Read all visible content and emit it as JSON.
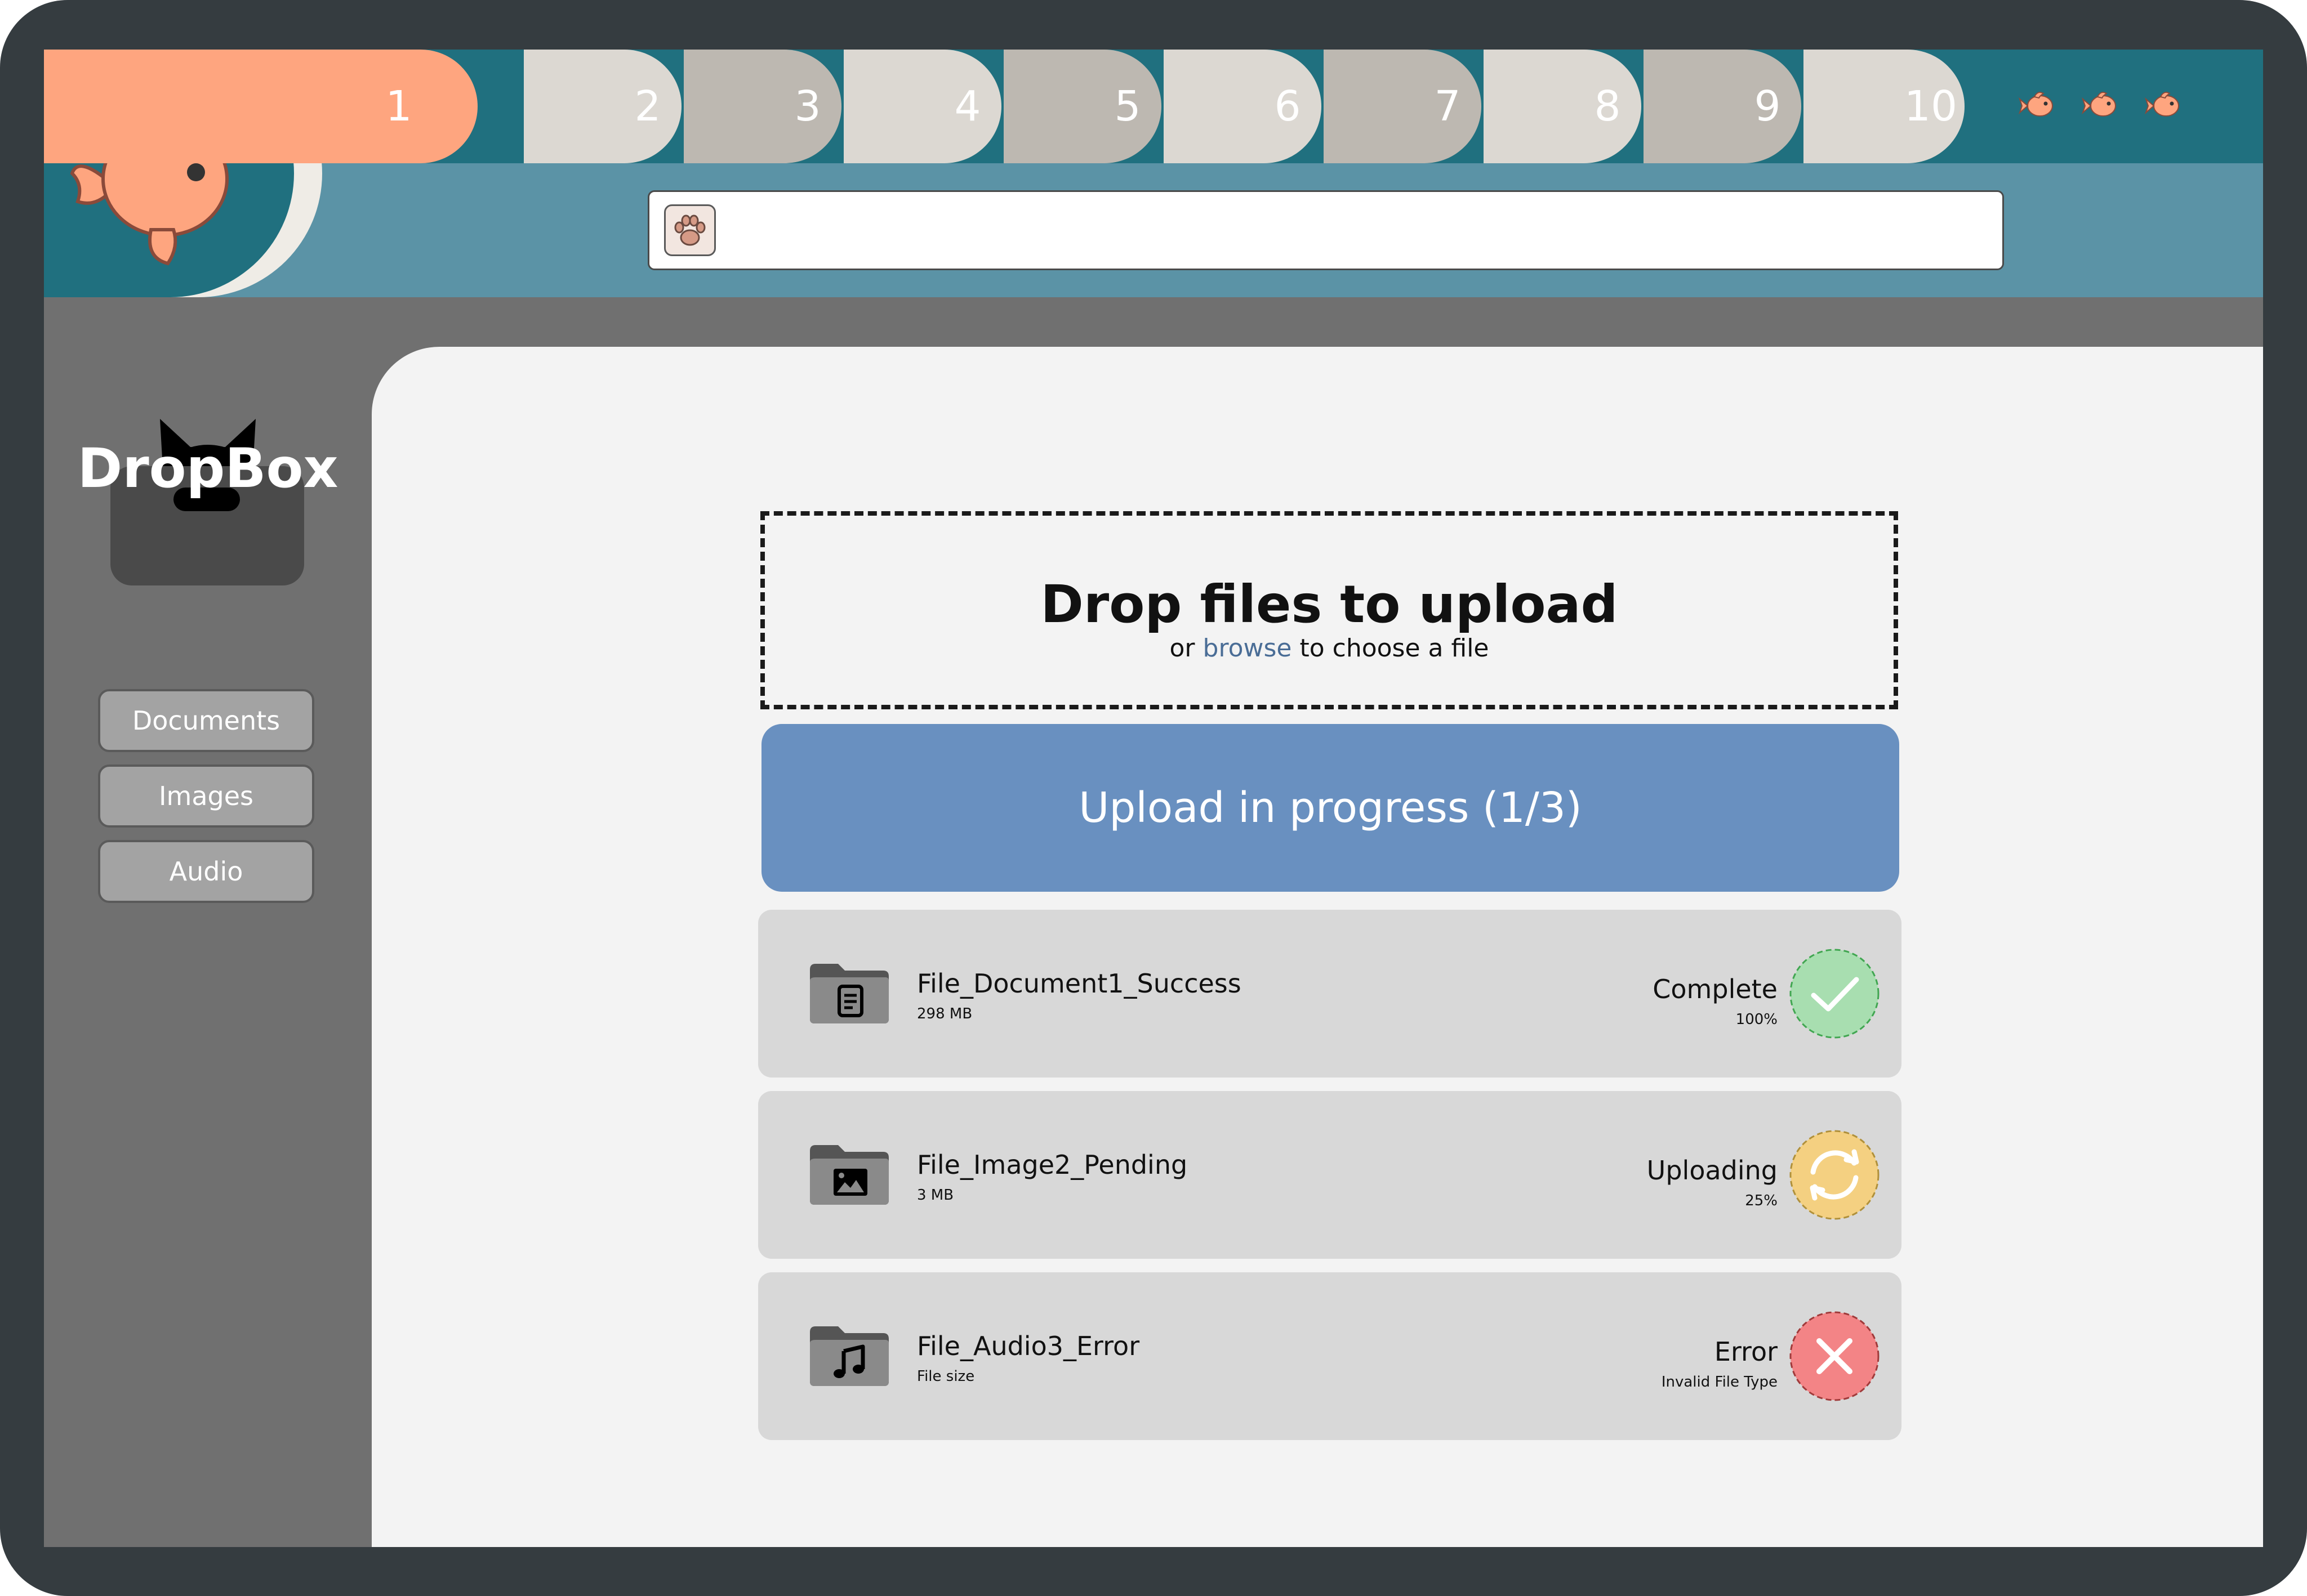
{
  "tabs": [
    {
      "label": "1",
      "active": true
    },
    {
      "label": "2",
      "active": false
    },
    {
      "label": "3",
      "active": false
    },
    {
      "label": "4",
      "active": false
    },
    {
      "label": "5",
      "active": false
    },
    {
      "label": "6",
      "active": false
    },
    {
      "label": "7",
      "active": false
    },
    {
      "label": "8",
      "active": false
    },
    {
      "label": "9",
      "active": false
    },
    {
      "label": "10",
      "active": false
    }
  ],
  "search": {
    "placeholder": "",
    "value": ""
  },
  "brand": {
    "name": "DropBox"
  },
  "sidebar": {
    "items": [
      {
        "label": "Documents"
      },
      {
        "label": "Images"
      },
      {
        "label": "Audio"
      }
    ]
  },
  "dropzone": {
    "title": "Drop files to upload",
    "sub_prefix": "or",
    "browse_label": "browse",
    "sub_suffix": "to choose a file"
  },
  "upload": {
    "label": "Upload in progress (1/3)"
  },
  "files": [
    {
      "name": "File_Document1_Success",
      "size": "298 MB",
      "status": "Complete",
      "detail": "100%",
      "progress": 1.0,
      "type_icon": "document-icon",
      "status_icon": "check-icon"
    },
    {
      "name": "File_Image2_Pending",
      "size": "3 MB",
      "status": "Uploading",
      "detail": "25%",
      "progress": 0.25,
      "type_icon": "image-icon",
      "status_icon": "sync-icon"
    },
    {
      "name": "File_Audio3_Error",
      "size": "File size",
      "status": "Error",
      "detail": "Invalid File Type",
      "type_icon": "music-note-icon",
      "status_icon": "error-x-icon"
    }
  ],
  "colors": {
    "frame": "#353c40",
    "teal": "#20707f",
    "topbar": "#5b93a6",
    "accent": "#fea57f",
    "progress": "#6990c0",
    "success": "#a8deb0",
    "pending": "#f4d081",
    "error": "#f38486"
  }
}
